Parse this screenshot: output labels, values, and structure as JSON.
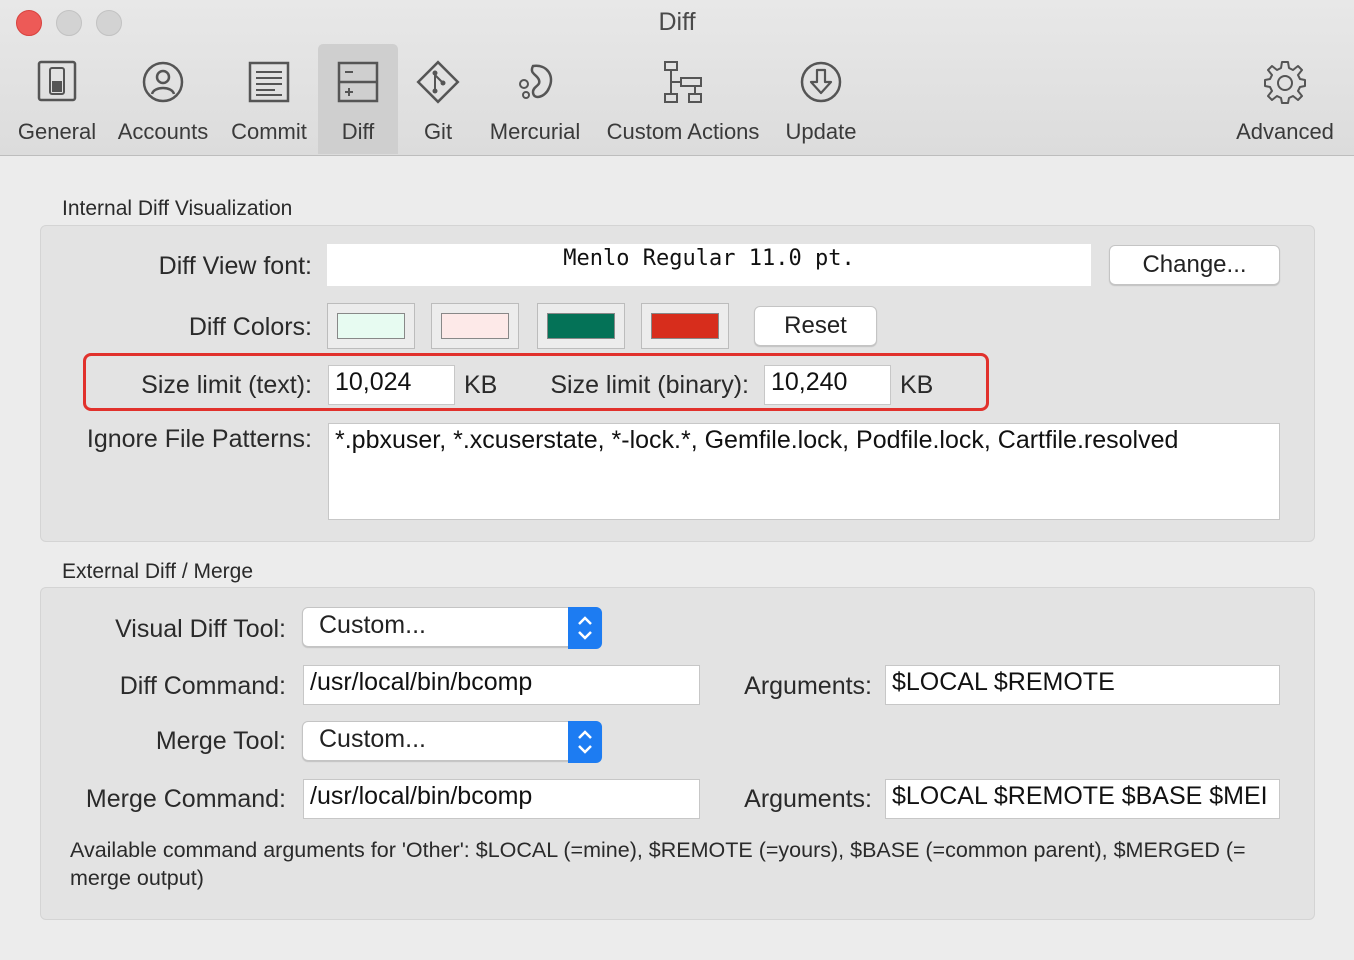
{
  "window": {
    "title": "Diff"
  },
  "toolbar": {
    "items": [
      {
        "label": "General",
        "icon": "general-switch-icon"
      },
      {
        "label": "Accounts",
        "icon": "accounts-person-icon"
      },
      {
        "label": "Commit",
        "icon": "commit-document-icon"
      },
      {
        "label": "Diff",
        "icon": "diff-icon",
        "selected": true
      },
      {
        "label": "Git",
        "icon": "git-icon"
      },
      {
        "label": "Mercurial",
        "icon": "mercurial-icon"
      },
      {
        "label": "Custom Actions",
        "icon": "custom-actions-icon"
      },
      {
        "label": "Update",
        "icon": "update-download-icon"
      },
      {
        "label": "Advanced",
        "icon": "gear-icon"
      }
    ]
  },
  "internal": {
    "section_title": "Internal Diff Visualization",
    "font_label": "Diff View font:",
    "font_value": "Menlo Regular 11.0 pt.",
    "change_button": "Change...",
    "colors_label": "Diff Colors:",
    "colors": [
      "#e7fbf1",
      "#fde9e8",
      "#047257",
      "#d72d1c"
    ],
    "reset_button": "Reset",
    "size_text_label": "Size limit (text):",
    "size_text_value": "10,024",
    "size_text_unit": "KB",
    "size_binary_label": "Size limit (binary):",
    "size_binary_value": "10,240",
    "size_binary_unit": "KB",
    "ignore_label": "Ignore File Patterns:",
    "ignore_value": "*.pbxuser, *.xcuserstate, *-lock.*, Gemfile.lock, Podfile.lock, Cartfile.resolved"
  },
  "external": {
    "section_title": "External Diff / Merge",
    "visual_label": "Visual Diff Tool:",
    "visual_value": "Custom...",
    "diff_cmd_label": "Diff Command:",
    "diff_cmd_value": "/usr/local/bin/bcomp",
    "diff_args_label": "Arguments:",
    "diff_args_value": "$LOCAL $REMOTE",
    "merge_label": "Merge Tool:",
    "merge_value": "Custom...",
    "merge_cmd_label": "Merge Command:",
    "merge_cmd_value": "/usr/local/bin/bcomp",
    "merge_args_label": "Arguments:",
    "merge_args_value": "$LOCAL $REMOTE $BASE $MEI",
    "help_text": "Available command arguments for 'Other': $LOCAL (=mine), $REMOTE (=yours), $BASE (=common parent), $MERGED (= merge output)"
  }
}
